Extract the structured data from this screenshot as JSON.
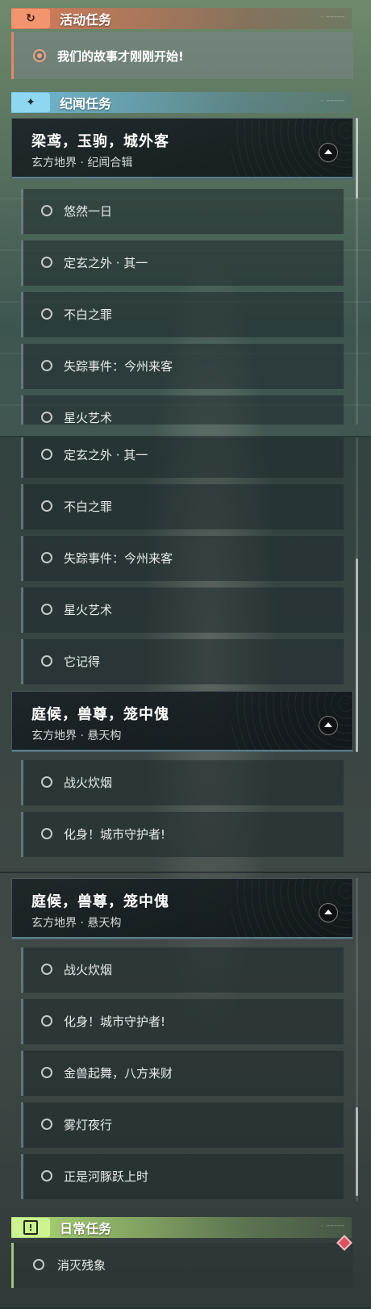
{
  "sections": {
    "event": {
      "title": "活动任务",
      "icon": "refresh-icon",
      "color": "#e5815f"
    },
    "story": {
      "title": "纪闻任务",
      "icon": "sparkle-icon",
      "color": "#7ecae8"
    },
    "daily": {
      "title": "日常任务",
      "icon": "exclamation-icon",
      "color": "#c4ee8c"
    }
  },
  "event_quest": {
    "label": "我们的故事才刚刚开始!",
    "tracked": true
  },
  "group_a": {
    "title": "梁鸢，玉驹，城外客",
    "subtitle": "玄方地界 · 纪闻合辑",
    "quests": [
      "悠然一日",
      "定玄之外 · 其一",
      "不白之罪",
      "失踪事件：今州来客",
      "星火艺术",
      "它记得"
    ]
  },
  "group_b": {
    "title": "庭候，兽尊，笼中傀",
    "subtitle": "玄方地界 · 悬天构",
    "quests": [
      "战火炊烟",
      "化身！城市守护者!",
      "金兽起舞，八方来财",
      "雾灯夜行",
      "正是河豚跃上时"
    ]
  },
  "daily_quest": {
    "label": "消灭残象"
  }
}
